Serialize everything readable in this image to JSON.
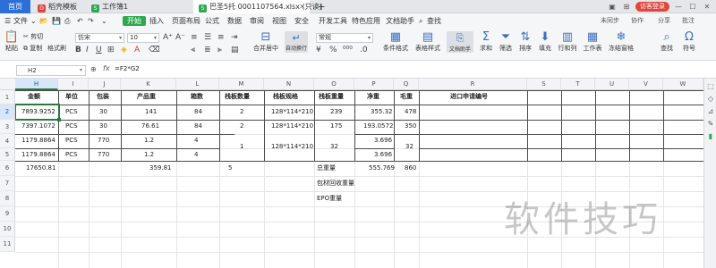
{
  "tabs": {
    "home": "首页",
    "templates": "稻壳模板",
    "book1": "工作簿1",
    "file": "巴圣5托 0001107564.xlsx (只读)",
    "add": "+"
  },
  "window": {
    "login": "访客登录"
  },
  "menu": {
    "file": "文件",
    "start": "开始",
    "items": [
      "插入",
      "页面布局",
      "公式",
      "数据",
      "审阅",
      "视图",
      "安全",
      "开发工具",
      "特色应用",
      "文档助手"
    ],
    "search": "查找",
    "sync": "未同步",
    "collab": "协作",
    "share": "分享",
    "comment": "批注"
  },
  "ribbon": {
    "paste": "粘贴",
    "cut": "剪切",
    "copy": "复制",
    "format_painter": "格式刷",
    "font": "仿宋",
    "size": "10",
    "merge_center": "合并居中",
    "wrap": "自动换行",
    "number_format": "常规",
    "cond_format": "条件格式",
    "table_style": "表格样式",
    "doc_helper": "文档助手",
    "sum": "求和",
    "filter": "筛选",
    "sort": "排序",
    "fill": "填充",
    "row_col": "行和列",
    "sheet": "工作表",
    "freeze": "冻结窗格",
    "find": "查找",
    "symbol": "符号"
  },
  "formula_bar": {
    "cell_ref": "H2",
    "fx": "fx",
    "formula": "=F2*G2"
  },
  "columns": [
    "H",
    "I",
    "J",
    "K",
    "L",
    "M",
    "N",
    "O",
    "P",
    "Q",
    "R",
    "S",
    "T",
    "U",
    "V",
    "W"
  ],
  "rows": [
    "1",
    "2",
    "3",
    "4",
    "5",
    "6",
    "7",
    "8",
    "9",
    "10",
    "11"
  ],
  "table": {
    "headers": [
      "金额",
      "单位",
      "包装",
      "产品重",
      "箱数",
      "栈板数量",
      "栈板规格",
      "栈板重量",
      "净重",
      "毛重",
      "进口申请编号"
    ],
    "rows": [
      {
        "amount": "7893.9252",
        "unit": "PCS",
        "pack": "30",
        "weight": "141",
        "boxes": "84",
        "pallets": "2",
        "spec": "128*114*210",
        "pallet_weight": "239",
        "net": "355.32",
        "gross": "478"
      },
      {
        "amount": "7397.1072",
        "unit": "PCS",
        "pack": "30",
        "weight": "76.61",
        "boxes": "84",
        "pallets": "2",
        "spec": "128*114*210",
        "pallet_weight": "175",
        "net": "193.0572",
        "gross": "350"
      },
      {
        "amount": "1179.8864",
        "unit": "PCS",
        "pack": "770",
        "weight": "1.2",
        "boxes": "4",
        "net": "3.696"
      },
      {
        "amount": "1179.8864",
        "unit": "PCS",
        "pack": "770",
        "weight": "1.2",
        "boxes": "4",
        "net": "3.696"
      }
    ],
    "merged_pallets": "1",
    "merged_spec": "128*114*210",
    "merged_pallet_weight": "32",
    "merged_gross": "32"
  },
  "totals": {
    "amount": "17650.81",
    "weight": "359.81",
    "pallets": "5",
    "label": "总重量",
    "net": "555.769",
    "gross": "860"
  },
  "notes": {
    "packaging": "包材回收重量",
    "epo": "EPO重量"
  },
  "watermark": "软件技巧",
  "colors": {
    "accent": "#2fa84f",
    "selection": "#2a7a3e",
    "home_tab": "#2d6fd6",
    "login": "#e0463b"
  }
}
